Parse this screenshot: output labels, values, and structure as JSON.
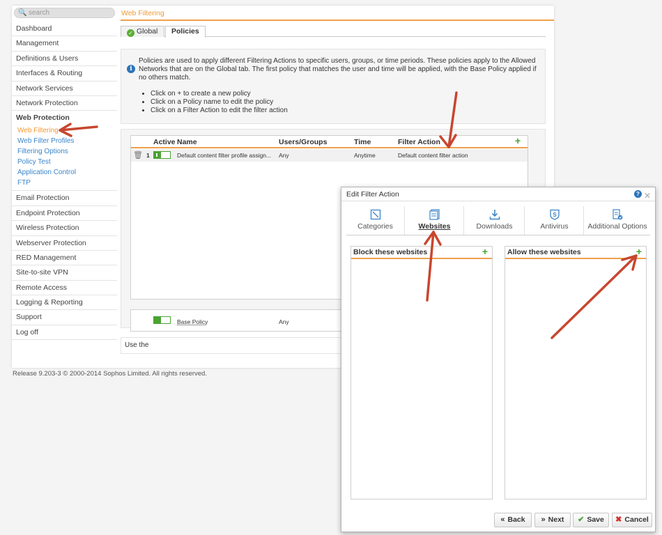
{
  "search": {
    "placeholder": "search"
  },
  "sidebar": {
    "items_top": [
      "Dashboard",
      "Management",
      "Definitions & Users",
      "Interfaces & Routing",
      "Network Services",
      "Network Protection"
    ],
    "group": {
      "title": "Web Protection",
      "subitems": [
        "Web Filtering",
        "Web Filter Profiles",
        "Filtering Options",
        "Policy Test",
        "Application Control",
        "FTP"
      ]
    },
    "items_bottom": [
      "Email Protection",
      "Endpoint Protection",
      "Wireless Protection",
      "Webserver Protection",
      "RED Management",
      "Site-to-site VPN",
      "Remote Access",
      "Logging & Reporting",
      "Support",
      "Log off"
    ]
  },
  "breadcrumb": "Web Filtering",
  "tabs": {
    "global": "Global",
    "policies": "Policies"
  },
  "info": {
    "text": "Policies are used to apply different Filtering Actions to specific users, groups, or time periods. These policies apply to the Allowed Networks that are on the Global tab. The first policy that matches the user and time will be applied, with the Base Policy applied if no others match.",
    "bullets": [
      "Click on + to create a new policy",
      "Click on a Policy name to edit the policy",
      "Click on a Filter Action to edit the filter action"
    ]
  },
  "table": {
    "headers": {
      "active": "Active",
      "name": "Name",
      "users": "Users/Groups",
      "time": "Time",
      "action": "Filter Action"
    },
    "row": {
      "num": "1",
      "name": "Default content filter profile assign...",
      "users": "Any",
      "time": "Anytime",
      "action": "Default content filter action"
    },
    "base": {
      "name": "Base Policy",
      "users": "Any"
    }
  },
  "use_the": "Use the",
  "footer": "Release 9.203-3  © 2000-2014 Sophos Limited. All rights reserved.",
  "dialog": {
    "title": "Edit Filter Action",
    "tabs": [
      "Categories",
      "Websites",
      "Downloads",
      "Antivirus",
      "Additional Options"
    ],
    "block_title": "Block these websites",
    "allow_title": "Allow these websites",
    "buttons": {
      "back": "Back",
      "next": "Next",
      "save": "Save",
      "cancel": "Cancel"
    }
  },
  "colors": {
    "accent": "#f0a04b",
    "link": "#3a85c9",
    "green": "#4aa332",
    "annotation": "#c8462f"
  }
}
